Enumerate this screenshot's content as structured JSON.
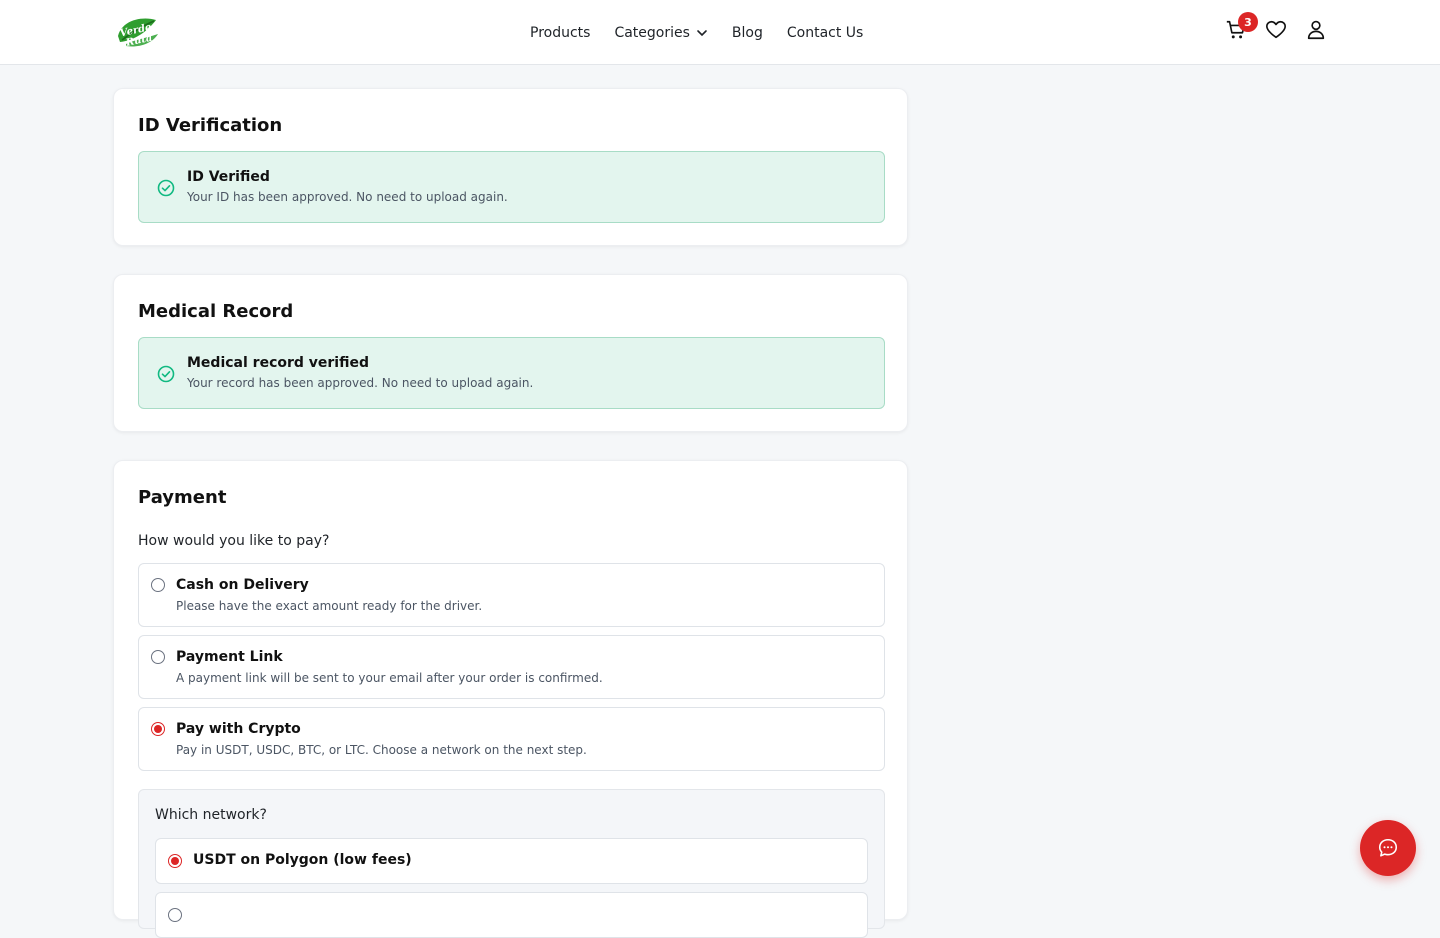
{
  "brand": {
    "logo_text": "Verde Ruta",
    "logo_icon": "leaf-logo"
  },
  "nav": {
    "products": "Products",
    "categories": "Categories",
    "blog": "Blog",
    "contact": "Contact Us"
  },
  "header": {
    "cart_count": "3"
  },
  "id_verification": {
    "title": "ID Verification",
    "status_title": "ID Verified",
    "status_desc": "Your ID has been approved. No need to upload again."
  },
  "medical_record": {
    "title": "Medical Record",
    "status_title": "Medical record verified",
    "status_desc": "Your record has been approved. No need to upload again."
  },
  "payment": {
    "title": "Payment",
    "question": "How would you like to pay?",
    "options": [
      {
        "title": "Cash on Delivery",
        "desc": "Please have the exact amount ready for the driver.",
        "selected": false
      },
      {
        "title": "Payment Link",
        "desc": "A payment link will be sent to your email after your order is confirmed.",
        "selected": false
      },
      {
        "title": "Pay with Crypto",
        "desc": "Pay in USDT, USDC, BTC, or LTC. Choose a network on the next step.",
        "selected": true
      }
    ],
    "network_question": "Which network?",
    "networks": [
      {
        "label": "USDT on Polygon (low fees)",
        "selected": true
      },
      {
        "label": "",
        "selected": false
      }
    ]
  },
  "colors": {
    "accent": "#dc2626",
    "success_bg": "#e3f5ee",
    "success_border": "#a8dcc6",
    "success_icon": "#10b981"
  }
}
